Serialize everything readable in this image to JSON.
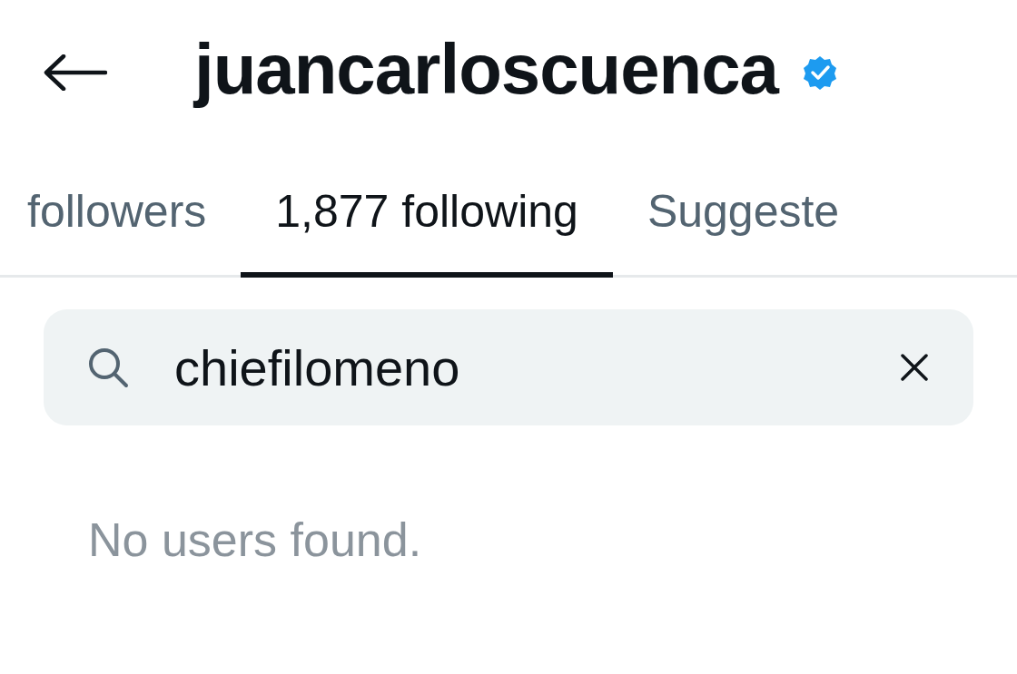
{
  "header": {
    "title": "juancarloscuenca",
    "verified": true
  },
  "tabs": [
    {
      "label": "followers",
      "selected": false
    },
    {
      "label": "1,877 following",
      "selected": true
    },
    {
      "label": "Suggeste",
      "selected": false
    }
  ],
  "search": {
    "value": "chiefilomeno"
  },
  "empty_message": "No users found."
}
